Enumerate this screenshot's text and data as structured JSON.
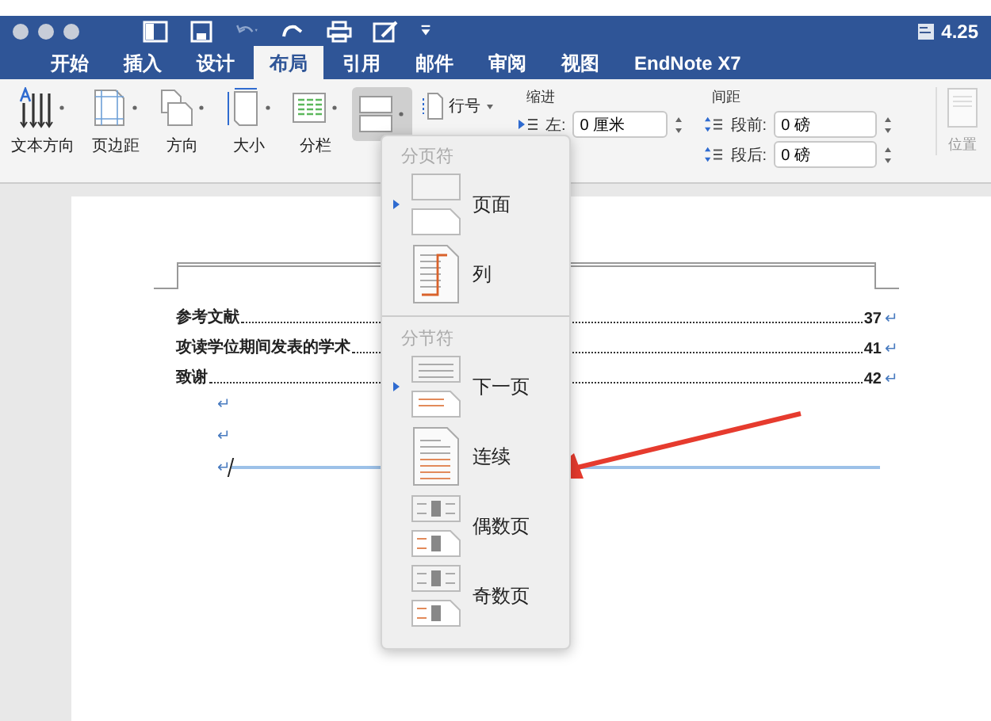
{
  "window": {
    "title": "4.25"
  },
  "tabs": [
    {
      "label": "开始",
      "selected": false
    },
    {
      "label": "插入",
      "selected": false
    },
    {
      "label": "设计",
      "selected": false
    },
    {
      "label": "布局",
      "selected": true
    },
    {
      "label": "引用",
      "selected": false
    },
    {
      "label": "邮件",
      "selected": false
    },
    {
      "label": "审阅",
      "selected": false
    },
    {
      "label": "视图",
      "selected": false
    },
    {
      "label": "EndNote X7",
      "selected": false
    }
  ],
  "ribbon": {
    "tools": [
      {
        "kind": "text-direction",
        "label": "文本方向"
      },
      {
        "kind": "margins",
        "label": "页边距"
      },
      {
        "kind": "orientation",
        "label": "方向"
      },
      {
        "kind": "size",
        "label": "大小"
      },
      {
        "kind": "columns",
        "label": "分栏"
      }
    ],
    "breaks_button": {
      "expanded": true
    },
    "line_numbers": {
      "label": "行号"
    },
    "indent": {
      "title": "缩进",
      "left_label": "左:",
      "left_value": "0 厘米"
    },
    "spacing": {
      "title": "间距",
      "before_label": "段前:",
      "before_value": "0 磅",
      "after_label": "段后:",
      "after_value": "0 磅"
    },
    "position": {
      "label": "位置"
    }
  },
  "breaks_menu": {
    "sections": [
      {
        "heading": "分页符",
        "items": [
          {
            "kind": "page",
            "label": "页面",
            "marked": true
          },
          {
            "kind": "column",
            "label": "列",
            "marked": false
          }
        ]
      },
      {
        "heading": "分节符",
        "items": [
          {
            "kind": "next-page",
            "label": "下一页",
            "marked": true
          },
          {
            "kind": "continuous",
            "label": "连续",
            "marked": false
          },
          {
            "kind": "even",
            "label": "偶数页",
            "marked": false
          },
          {
            "kind": "odd",
            "label": "奇数页",
            "marked": false
          }
        ]
      }
    ]
  },
  "document": {
    "toc": [
      {
        "title": "参考文献",
        "page": "37",
        "mark": "↵"
      },
      {
        "title": "攻读学位期间发表的学术",
        "page": "41",
        "mark": "↵"
      },
      {
        "title": "致谢",
        "page": "42",
        "mark": "↵"
      }
    ],
    "empty_paragraphs": [
      "↵",
      "↵",
      "↵"
    ]
  }
}
